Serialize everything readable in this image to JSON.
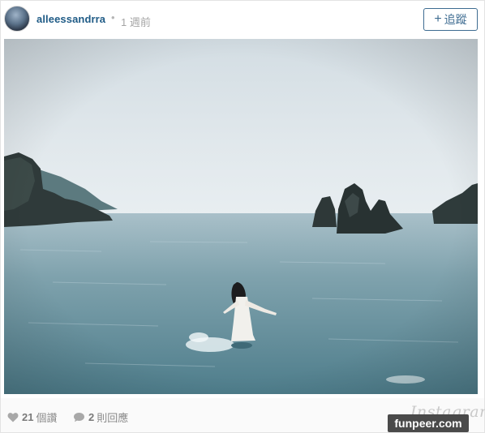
{
  "header": {
    "username": "alleessandrra",
    "separator": "•",
    "time": "1 週前",
    "follow_label": "追蹤",
    "follow_icon": "plus-icon"
  },
  "photo": {
    "subject": "woman-wading-in-sea-photo"
  },
  "footer": {
    "likes_count": "21",
    "likes_label": "個讚",
    "likes_icon": "heart-icon",
    "comments_count": "2",
    "comments_label": "則回應",
    "comments_icon": "comment-bubble-icon",
    "brand": "Instagram"
  },
  "watermark": {
    "text": "funpeer.com"
  },
  "colors": {
    "username": "#1f5b86",
    "follow_border": "#3e6c91",
    "meta": "#a5a5a5",
    "watermark_bg": "#4a4a4a"
  }
}
